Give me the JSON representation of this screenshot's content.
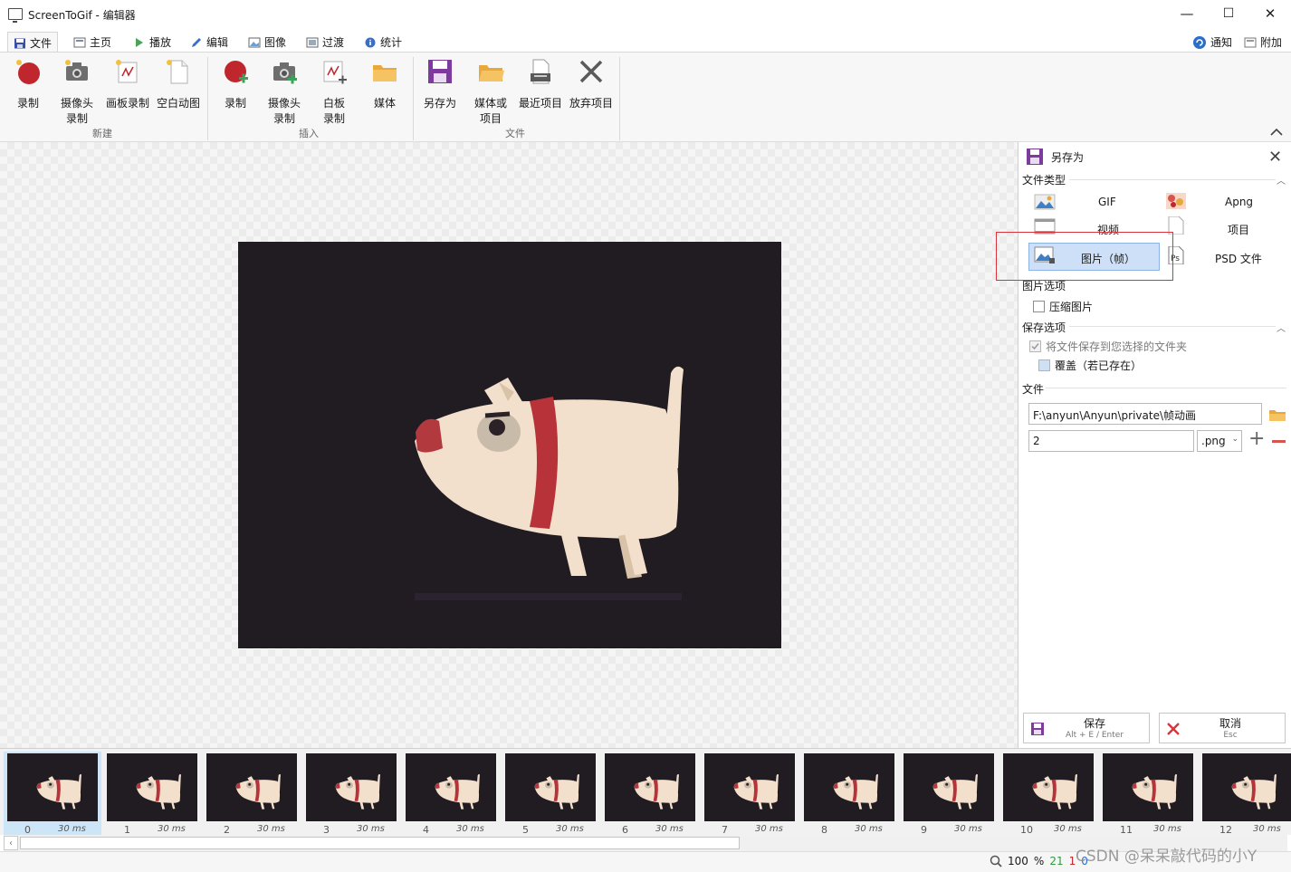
{
  "window": {
    "title": "ScreenToGif - 编辑器",
    "minimize": "—",
    "maximize": "☐",
    "close": "✕"
  },
  "tabs": [
    {
      "label": "文件",
      "icon": "save-icon",
      "active": true
    },
    {
      "label": "主页",
      "icon": "home-icon"
    },
    {
      "label": "播放",
      "icon": "play-icon"
    },
    {
      "label": "编辑",
      "icon": "pencil-icon"
    },
    {
      "label": "图像",
      "icon": "image-icon"
    },
    {
      "label": "过渡",
      "icon": "transition-icon"
    },
    {
      "label": "统计",
      "icon": "info-icon"
    }
  ],
  "tabs_right": {
    "notify": "通知",
    "extra": "附加"
  },
  "ribbon": {
    "groups": [
      {
        "label": "新建",
        "buttons": [
          {
            "label": "录制",
            "icon": "record-icon"
          },
          {
            "label": "摄像头",
            "label2": "录制",
            "icon": "camera-icon"
          },
          {
            "label": "画板录制",
            "icon": "board-icon"
          },
          {
            "label": "空白动图",
            "icon": "blank-file-icon"
          }
        ]
      },
      {
        "label": "插入",
        "buttons": [
          {
            "label": "录制",
            "icon": "record-add-icon"
          },
          {
            "label": "摄像头",
            "label2": "录制",
            "icon": "camera-add-icon"
          },
          {
            "label": "白板",
            "label2": "录制",
            "icon": "whiteboard-icon"
          },
          {
            "label": "媒体",
            "icon": "folder-icon"
          }
        ]
      },
      {
        "label": "文件",
        "buttons": [
          {
            "label": "另存为",
            "icon": "save-as-icon"
          },
          {
            "label": "媒体或",
            "label2": "项目",
            "icon": "open-folder-icon"
          },
          {
            "label": "最近项目",
            "icon": "recent-icon"
          },
          {
            "label": "放弃项目",
            "icon": "discard-icon"
          }
        ]
      }
    ]
  },
  "panel": {
    "title": "另存为",
    "file_type_label": "文件类型",
    "types": {
      "gif": "GIF",
      "apng": "Apng",
      "video": "视频",
      "project": "项目",
      "image": "图片（帧）",
      "psd": "PSD 文件",
      "psd_icon_text": "Ps"
    },
    "image_options_label": "图片选项",
    "compress_label": "压缩图片",
    "save_options_label": "保存选项",
    "save_to_folder_label": "将文件保存到您选择的文件夹",
    "overwrite_label": "覆盖（若已存在）",
    "file_label": "文件",
    "path": "F:\\anyun\\Anyun\\private\\帧动画",
    "filename": "2",
    "extension": ".png",
    "save_label": "保存",
    "save_shortcut": "Alt + E / Enter",
    "cancel_label": "取消",
    "cancel_shortcut": "Esc"
  },
  "frames": [
    {
      "index": "0",
      "delay": "30 ms"
    },
    {
      "index": "1",
      "delay": "30 ms"
    },
    {
      "index": "2",
      "delay": "30 ms"
    },
    {
      "index": "3",
      "delay": "30 ms"
    },
    {
      "index": "4",
      "delay": "30 ms"
    },
    {
      "index": "5",
      "delay": "30 ms"
    },
    {
      "index": "6",
      "delay": "30 ms"
    },
    {
      "index": "7",
      "delay": "30 ms"
    },
    {
      "index": "8",
      "delay": "30 ms"
    },
    {
      "index": "9",
      "delay": "30 ms"
    },
    {
      "index": "10",
      "delay": "30 ms"
    },
    {
      "index": "11",
      "delay": "30 ms"
    },
    {
      "index": "12",
      "delay": "30 ms"
    }
  ],
  "status": {
    "zoom": "100",
    "zoom_unit": "%",
    "frame_count": "21",
    "selected": "1",
    "other": "0"
  },
  "watermark": "CSDN @呆呆敲代码的小Y",
  "colors": {
    "accent": "#1e7bd6",
    "highlight": "#cde0f7",
    "red_box": "#d9343d",
    "frame_bg": "#211b22"
  }
}
